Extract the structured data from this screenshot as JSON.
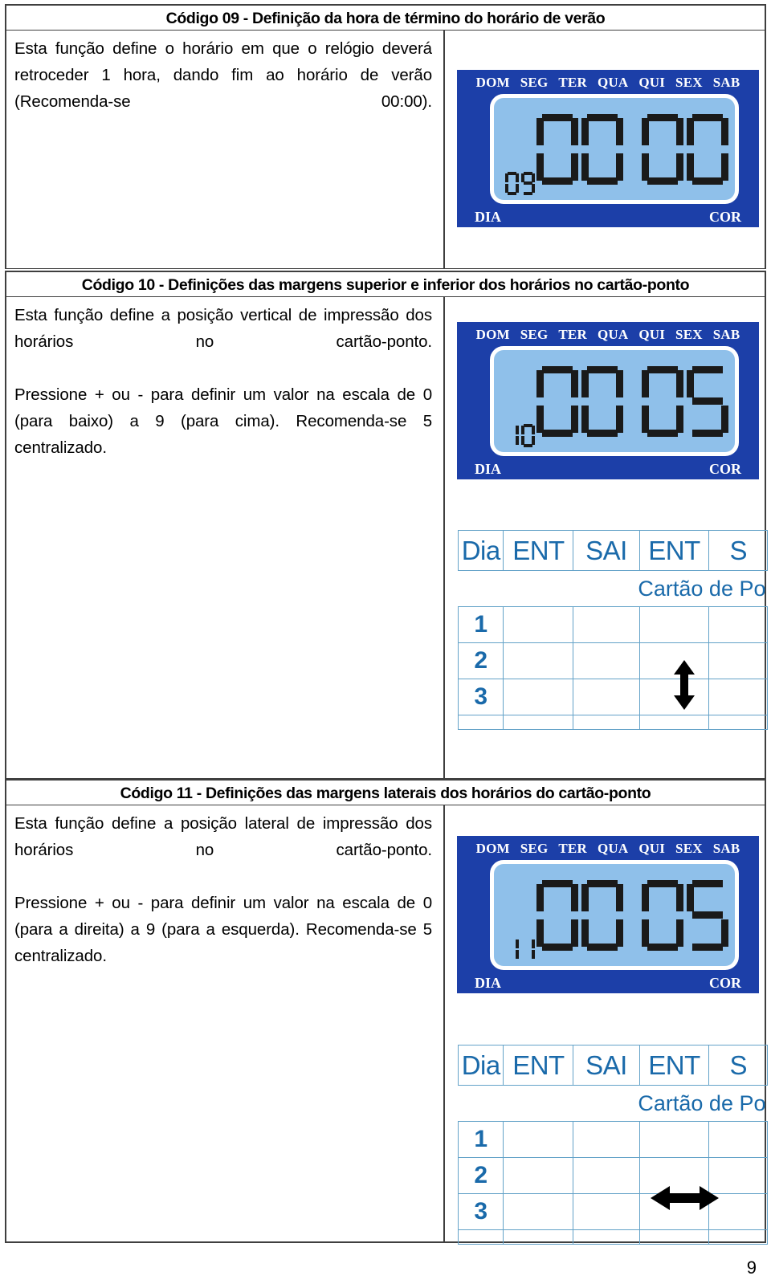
{
  "document": {
    "page_number": "9"
  },
  "sections": [
    {
      "header": "Código 09 - Definição da hora de término do horário de verão",
      "paragraphs": [
        "Esta função define o horário em que o relógio deverá retroceder 1 hora, dando fim ao horário de verão (Recomenda-se 00:00)."
      ],
      "lcd": {
        "days": [
          "DOM",
          "SEG",
          "TER",
          "QUA",
          "QUI",
          "SEX",
          "SAB"
        ],
        "digits": "0000",
        "code": "09",
        "left_label": "DIA",
        "right_label": "COR",
        "frame_color": "#1c3fa8",
        "screen_color": "#8fc0ea",
        "segment_color": "#1a1a1a"
      },
      "card_grid": null
    },
    {
      "header": "Código 10 - Definições das margens superior e inferior dos horários no cartão-ponto",
      "paragraphs": [
        "Esta função define a posição vertical de impressão dos horários no cartão-ponto.",
        "Pressione + ou - para definir um valor na escala de 0 (para baixo) a 9 (para cima). Recomenda-se 5 centralizado."
      ],
      "lcd": {
        "days": [
          "DOM",
          "SEG",
          "TER",
          "QUA",
          "QUI",
          "SEX",
          "SAB"
        ],
        "digits": "0005",
        "code": "10",
        "left_label": "DIA",
        "right_label": "COR",
        "frame_color": "#1c3fa8",
        "screen_color": "#8fc0ea",
        "segment_color": "#1a1a1a"
      },
      "card_grid": {
        "columns": [
          "Dia",
          "ENT",
          "SAI",
          "ENT",
          "S"
        ],
        "subtitle": "Cartão de Po",
        "day_rows": [
          "1",
          "2",
          "3"
        ],
        "arrow": "vertical-double-arrow",
        "line_color": "#63a2c8",
        "text_color": "#1a6aaa"
      }
    },
    {
      "header": "Código 11 - Definições das margens laterais dos horários do cartão-ponto",
      "paragraphs": [
        "Esta função define a posição lateral de impressão dos horários no cartão-ponto.",
        "Pressione + ou - para definir um valor na escala de 0 (para a direita) a 9 (para a esquerda). Recomenda-se 5 centralizado."
      ],
      "lcd": {
        "days": [
          "DOM",
          "SEG",
          "TER",
          "QUA",
          "QUI",
          "SEX",
          "SAB"
        ],
        "digits": "0005",
        "code": "11",
        "left_label": "DIA",
        "right_label": "COR",
        "frame_color": "#1c3fa8",
        "screen_color": "#8fc0ea",
        "segment_color": "#1a1a1a"
      },
      "card_grid": {
        "columns": [
          "Dia",
          "ENT",
          "SAI",
          "ENT",
          "S"
        ],
        "subtitle": "Cartão de Po",
        "day_rows": [
          "1",
          "2",
          "3"
        ],
        "arrow": "horizontal-double-arrow",
        "line_color": "#63a2c8",
        "text_color": "#1a6aaa"
      }
    }
  ]
}
